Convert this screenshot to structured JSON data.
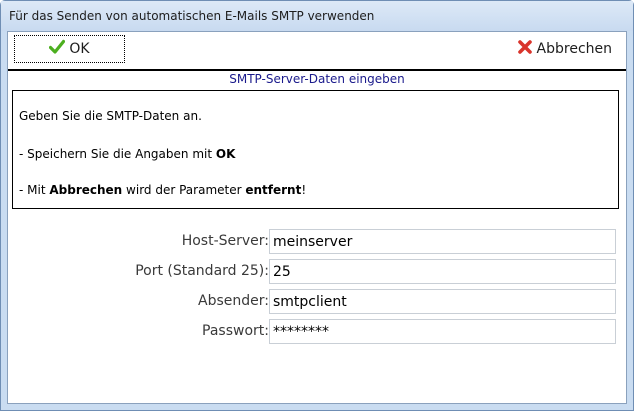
{
  "window": {
    "title": "Für das Senden von automatischen E-Mails SMTP verwenden"
  },
  "toolbar": {
    "ok_label": "OK",
    "cancel_label": "Abbrechen"
  },
  "section": {
    "title": "SMTP-Server-Daten eingeben"
  },
  "info": {
    "line1": "Geben Sie die SMTP-Daten an.",
    "line2_prefix": "- Speichern Sie die Angaben mit ",
    "line2_bold": "OK",
    "line3_prefix": "- Mit ",
    "line3_bold1": "Abbrechen",
    "line3_mid": " wird der Parameter ",
    "line3_bold2": "entfernt",
    "line3_suffix": "!"
  },
  "form": {
    "host_label": "Host-Server:",
    "host_value": "meinserver",
    "port_label": "Port (Standard 25):",
    "port_value": "25",
    "sender_label": "Absender:",
    "sender_value": "smtpclient",
    "password_label": "Passwort:",
    "password_value": "********"
  },
  "colors": {
    "ok_icon": "#4caf1f",
    "cancel_icon": "#d9342b",
    "section_title": "#1a1a8c"
  }
}
